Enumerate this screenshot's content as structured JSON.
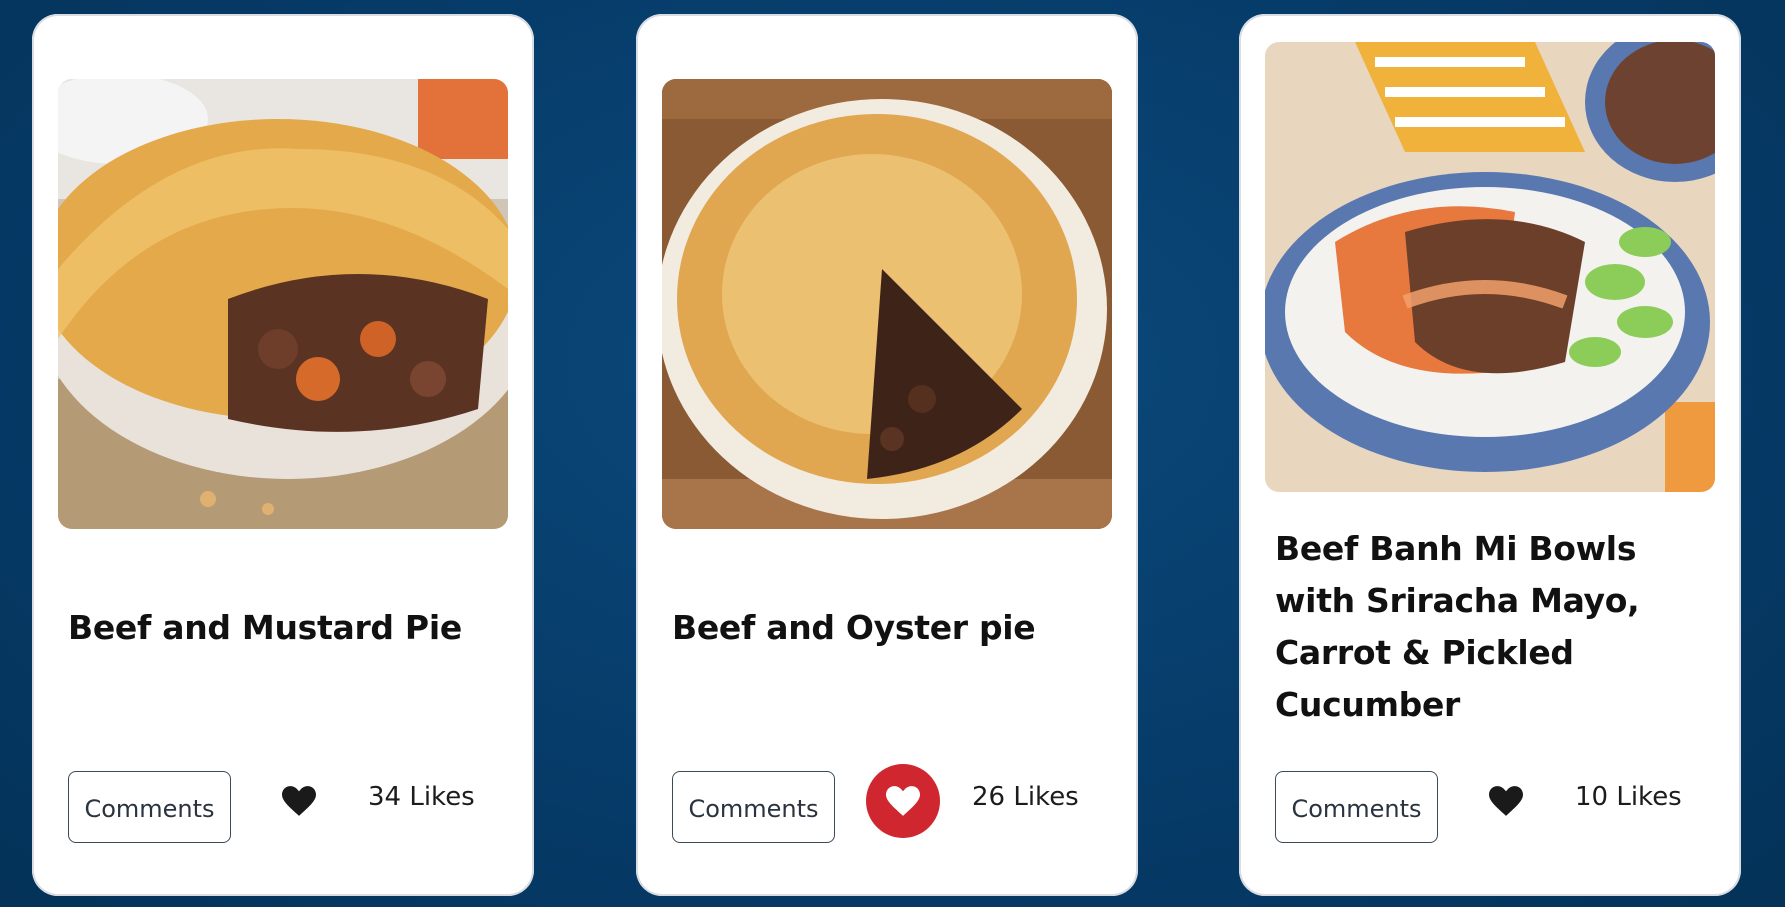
{
  "colors": {
    "background": "#063c6a",
    "card": "#ffffff",
    "heart_default": "#1a1a1a",
    "heart_active_bg": "#d0262f"
  },
  "recipes": [
    {
      "title": "Beef and Mustard Pie",
      "image_subject": "beef-mustard-pie-photo",
      "comments_label": "Comments",
      "liked": false,
      "likes_text": "34 Likes"
    },
    {
      "title": "Beef and Oyster pie",
      "image_subject": "beef-oyster-pie-photo",
      "comments_label": "Comments",
      "liked": true,
      "likes_text": "26 Likes"
    },
    {
      "title": "Beef Banh Mi Bowls with Sriracha Mayo, Carrot & Pickled Cucumber",
      "image_subject": "banh-mi-bowl-photo",
      "comments_label": "Comments",
      "liked": false,
      "likes_text": "10 Likes"
    }
  ]
}
